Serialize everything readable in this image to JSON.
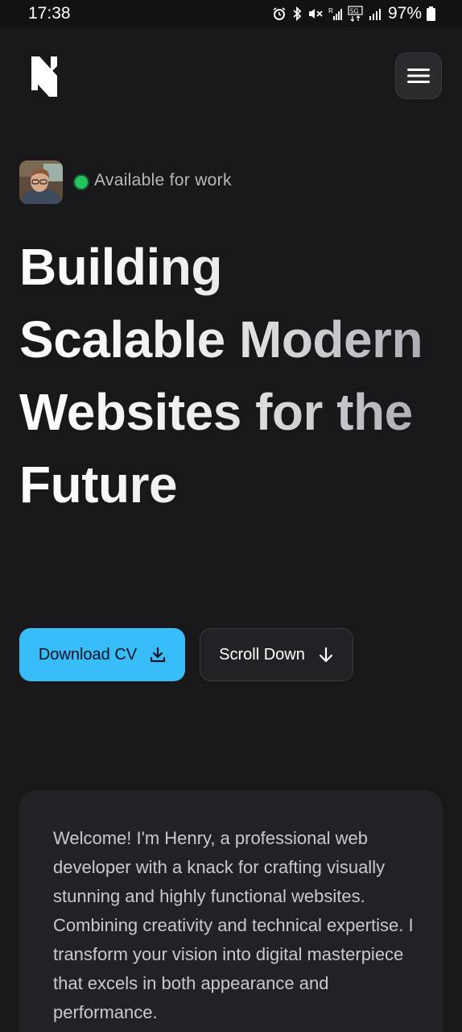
{
  "status_bar": {
    "time": "17:38",
    "battery": "97%",
    "icons": [
      "alarm-icon",
      "bluetooth-icon",
      "mute-icon",
      "signal-r-icon",
      "5g-icon",
      "signal-icon",
      "battery-icon"
    ]
  },
  "header": {
    "logo": "logo-icon",
    "menu_icon": "hamburger-icon"
  },
  "hero": {
    "availability": "Available for work",
    "headline": "Building Scalable Modern Websites for the Future",
    "buttons": {
      "download_cv": "Download CV",
      "scroll_down": "Scroll Down"
    }
  },
  "intro": {
    "text": "Welcome! I'm Henry, a professional web developer with a knack for crafting visually stunning and highly functional websites. Combining creativity and technical expertise. I transform your vision into digital masterpiece that excels in both appearance and performance."
  },
  "colors": {
    "background": "#18181b",
    "accent": "#38bdf8",
    "available": "#22c55e",
    "card": "#222226"
  }
}
